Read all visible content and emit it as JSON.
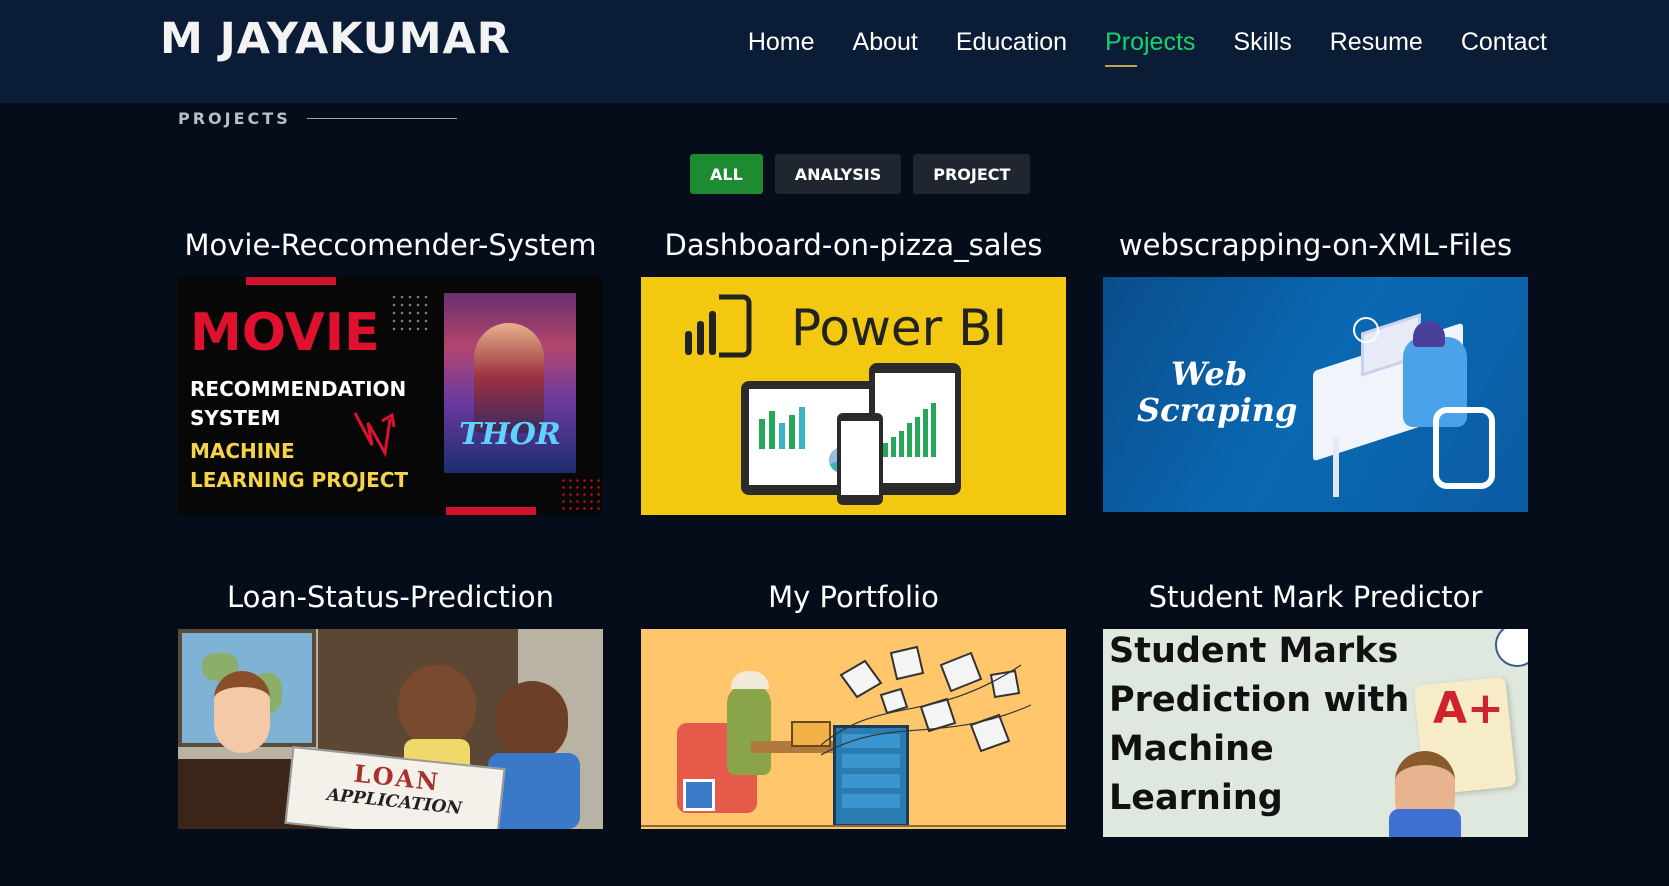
{
  "header": {
    "brand": "M JAYAKUMAR",
    "nav": [
      {
        "label": "Home",
        "active": false
      },
      {
        "label": "About",
        "active": false
      },
      {
        "label": "Education",
        "active": false
      },
      {
        "label": "Projects",
        "active": true
      },
      {
        "label": "Skills",
        "active": false
      },
      {
        "label": "Resume",
        "active": false
      },
      {
        "label": "Contact",
        "active": false
      }
    ]
  },
  "section": {
    "title": "PROJECTS"
  },
  "filters": [
    {
      "label": "ALL",
      "active": true
    },
    {
      "label": "ANALYSIS",
      "active": false
    },
    {
      "label": "PROJECT",
      "active": false
    }
  ],
  "projects": [
    {
      "title": "Movie-Reccomender-System",
      "image": {
        "icon": "movie-recommendation-thumbnail",
        "lines": [
          "MOVIE",
          "RECOMMENDATION",
          "SYSTEM",
          "MACHINE",
          "LEARNING PROJECT"
        ],
        "poster": "THOR"
      }
    },
    {
      "title": "Dashboard-on-pizza_sales",
      "image": {
        "icon": "power-bi-thumbnail",
        "lines": [
          "Power BI"
        ]
      }
    },
    {
      "title": "webscrapping-on-XML-Files",
      "image": {
        "icon": "web-scraping-thumbnail",
        "lines": [
          "Web",
          "Scraping"
        ]
      }
    },
    {
      "title": "Loan-Status-Prediction",
      "image": {
        "icon": "loan-application-thumbnail",
        "lines": [
          "LOAN",
          "APPLICATION"
        ]
      }
    },
    {
      "title": "My Portfolio",
      "image": {
        "icon": "portfolio-thumbnail",
        "lines": []
      }
    },
    {
      "title": "Student Mark Predictor",
      "image": {
        "icon": "student-marks-thumbnail",
        "lines": [
          "Student Marks",
          "Prediction with",
          "Machine",
          "Learning"
        ],
        "grade": "A+"
      }
    }
  ],
  "colors": {
    "header_bg": "#0b1c36",
    "page_bg": "#040d19",
    "accent": "#18d26e",
    "filter_active": "#1e8a32"
  }
}
